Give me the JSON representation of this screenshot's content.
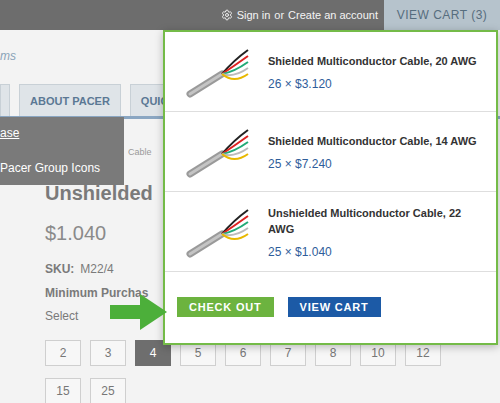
{
  "header": {
    "sign_in": "Sign in",
    "or": "or",
    "create_account": "Create an account",
    "view_cart": "VIEW CART (3)"
  },
  "breadcrumb_link": "ms",
  "nav_tabs": [
    {
      "label": ""
    },
    {
      "label": "ABOUT PACER"
    },
    {
      "label": "QUIC"
    }
  ],
  "dropdown": {
    "items": [
      {
        "label": "ase",
        "hovered": true
      },
      {
        "label": "Pacer Group Icons",
        "hovered": false
      }
    ]
  },
  "breadcrumb": "Cable",
  "product": {
    "title": "Unshielded",
    "price": "$1.040",
    "sku_label": "SKU:",
    "sku": "M22/4",
    "minimum": "Minimum Purchas",
    "select": "Select"
  },
  "quantities": [
    {
      "label": "2",
      "selected": false
    },
    {
      "label": "3",
      "selected": false
    },
    {
      "label": "4",
      "selected": true
    },
    {
      "label": "5",
      "selected": false
    },
    {
      "label": "6",
      "selected": false
    },
    {
      "label": "7",
      "selected": false
    },
    {
      "label": "8",
      "selected": false
    },
    {
      "label": "10",
      "selected": false
    },
    {
      "label": "12",
      "selected": false
    },
    {
      "label": "15",
      "selected": false
    },
    {
      "label": "25",
      "selected": false
    }
  ],
  "cart_popup": {
    "items": [
      {
        "name": "Shielded Multiconductor Cable, 20 AWG",
        "price_line": "26 × $3.120"
      },
      {
        "name": "Shielded Multiconductor Cable, 14 AWG",
        "price_line": "25 × $7.240"
      },
      {
        "name": "Unshielded Multiconductor Cable, 22 AWG",
        "price_line": "25 × $1.040"
      }
    ],
    "checkout": "CHECK OUT",
    "view_cart": "VIEW CART"
  }
}
